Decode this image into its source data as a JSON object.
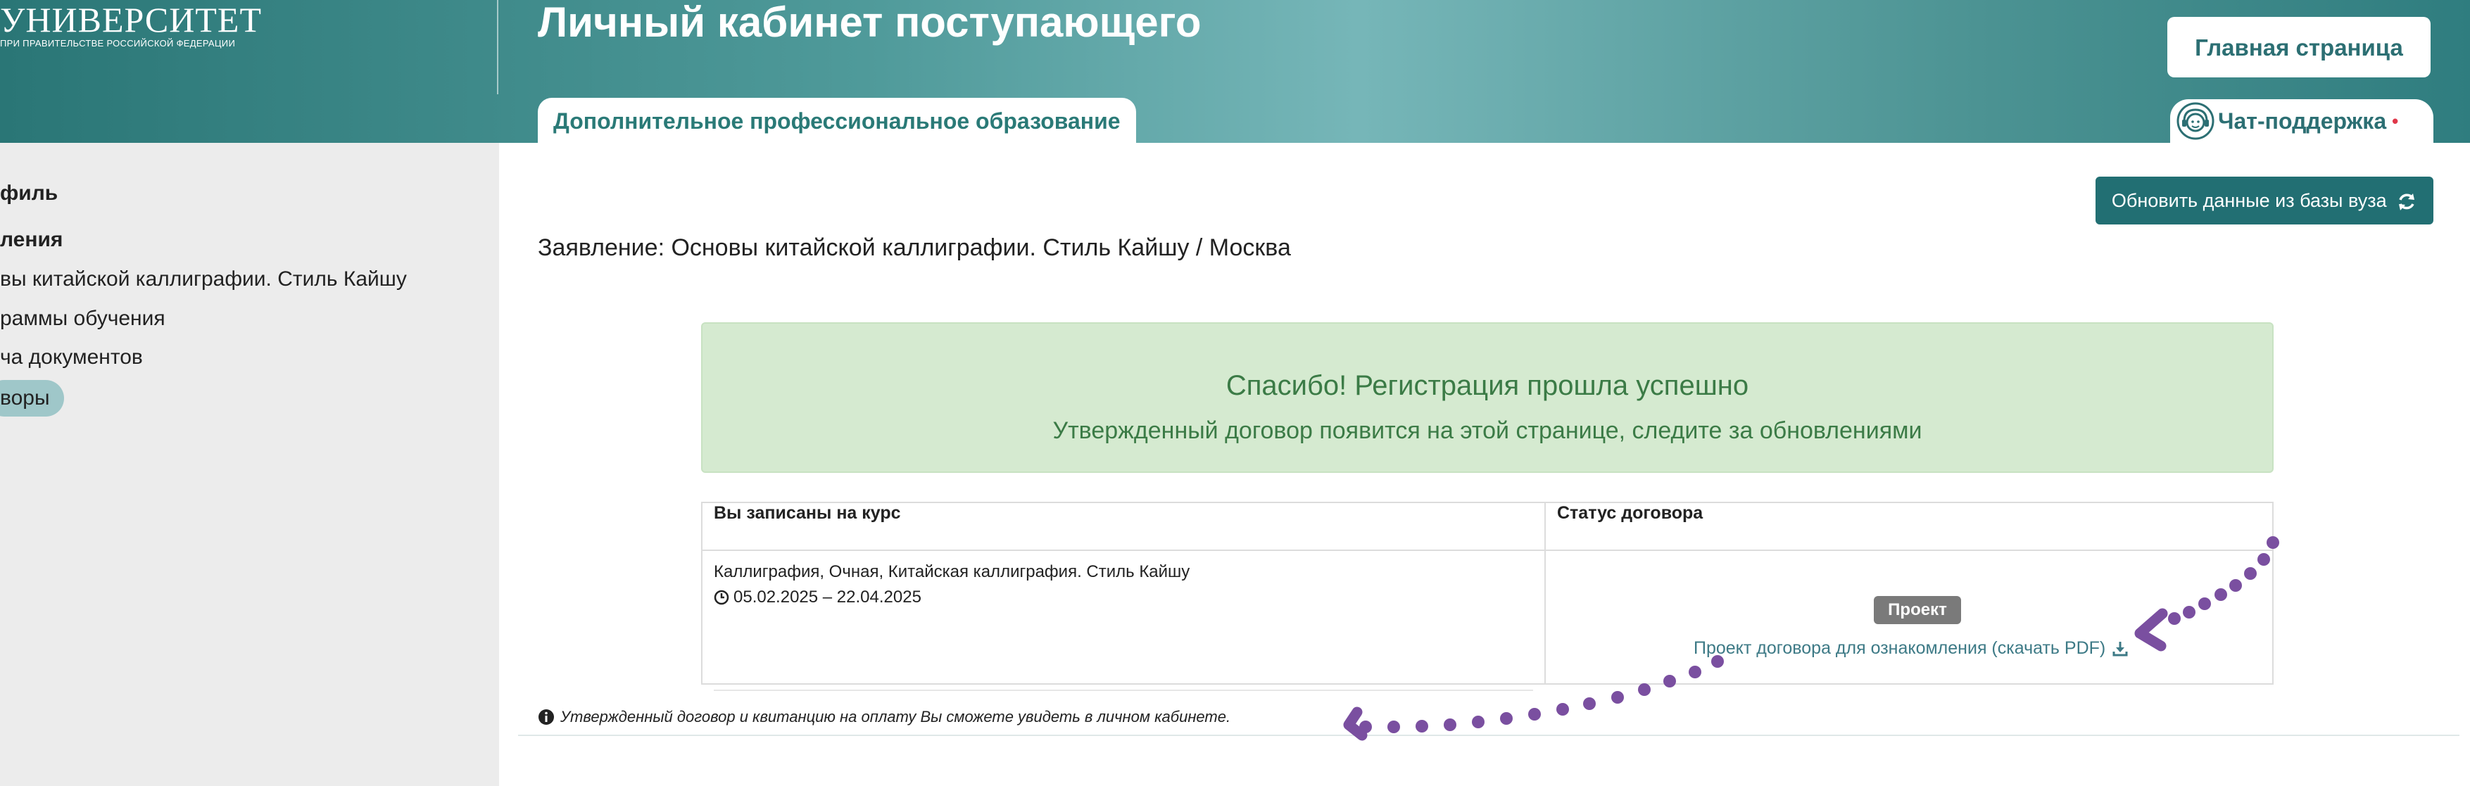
{
  "header": {
    "logo_title": "УНИВЕРСИТЕТ",
    "logo_subtitle": "ПРИ ПРАВИТЕЛЬСТВЕ РОССИЙСКОЙ ФЕДЕРАЦИИ",
    "page_title": "Личный кабинет поступающего",
    "active_tab": "Дополнительное профессиональное образование",
    "home_button": "Главная страница",
    "chat_support": "Чат-поддержка",
    "chat_indicator": "•",
    "chat_icon": "support-agent-icon"
  },
  "sidebar": {
    "items": [
      {
        "label": "филь",
        "bold": true
      },
      {
        "label": "ления",
        "bold": true
      },
      {
        "label": "вы китайской каллиграфии. Стиль Кайшу",
        "bold": false
      },
      {
        "label": "раммы обучения",
        "bold": false
      },
      {
        "label": "ча документов",
        "bold": false
      },
      {
        "label": "воры",
        "bold": false,
        "active": true
      }
    ]
  },
  "main": {
    "refresh_button": "Обновить данные из базы вуза",
    "refresh_icon": "refresh-icon",
    "application_title": "Заявление: Основы китайской каллиграфии. Стиль Кайшу / Москва",
    "alert": {
      "title": "Спасибо! Регистрация прошла успешно",
      "text": "Утвержденный договор появится на этой странице, следите за обновлениями"
    },
    "table": {
      "col_course": "Вы записаны на курс",
      "col_status": "Статус договора",
      "course_name": "Каллиграфия, Очная, Китайская каллиграфия. Стиль Кайшу",
      "course_dates": "05.02.2025 – 22.04.2025",
      "status_badge": "Проект",
      "pdf_link": "Проект договора для ознакомления (скачать PDF)"
    },
    "note": "Утвержденный договор и квитанцию на оплату Вы сможете увидеть в личном кабинете."
  },
  "colors": {
    "header_teal": "#4f9a9a",
    "accent_dark_teal": "#226f73",
    "alert_green_bg": "#d5ead0",
    "alert_green_text": "#3b7b46",
    "annotation_purple": "#7a4fa0",
    "badge_gray": "#7a7a7a"
  }
}
